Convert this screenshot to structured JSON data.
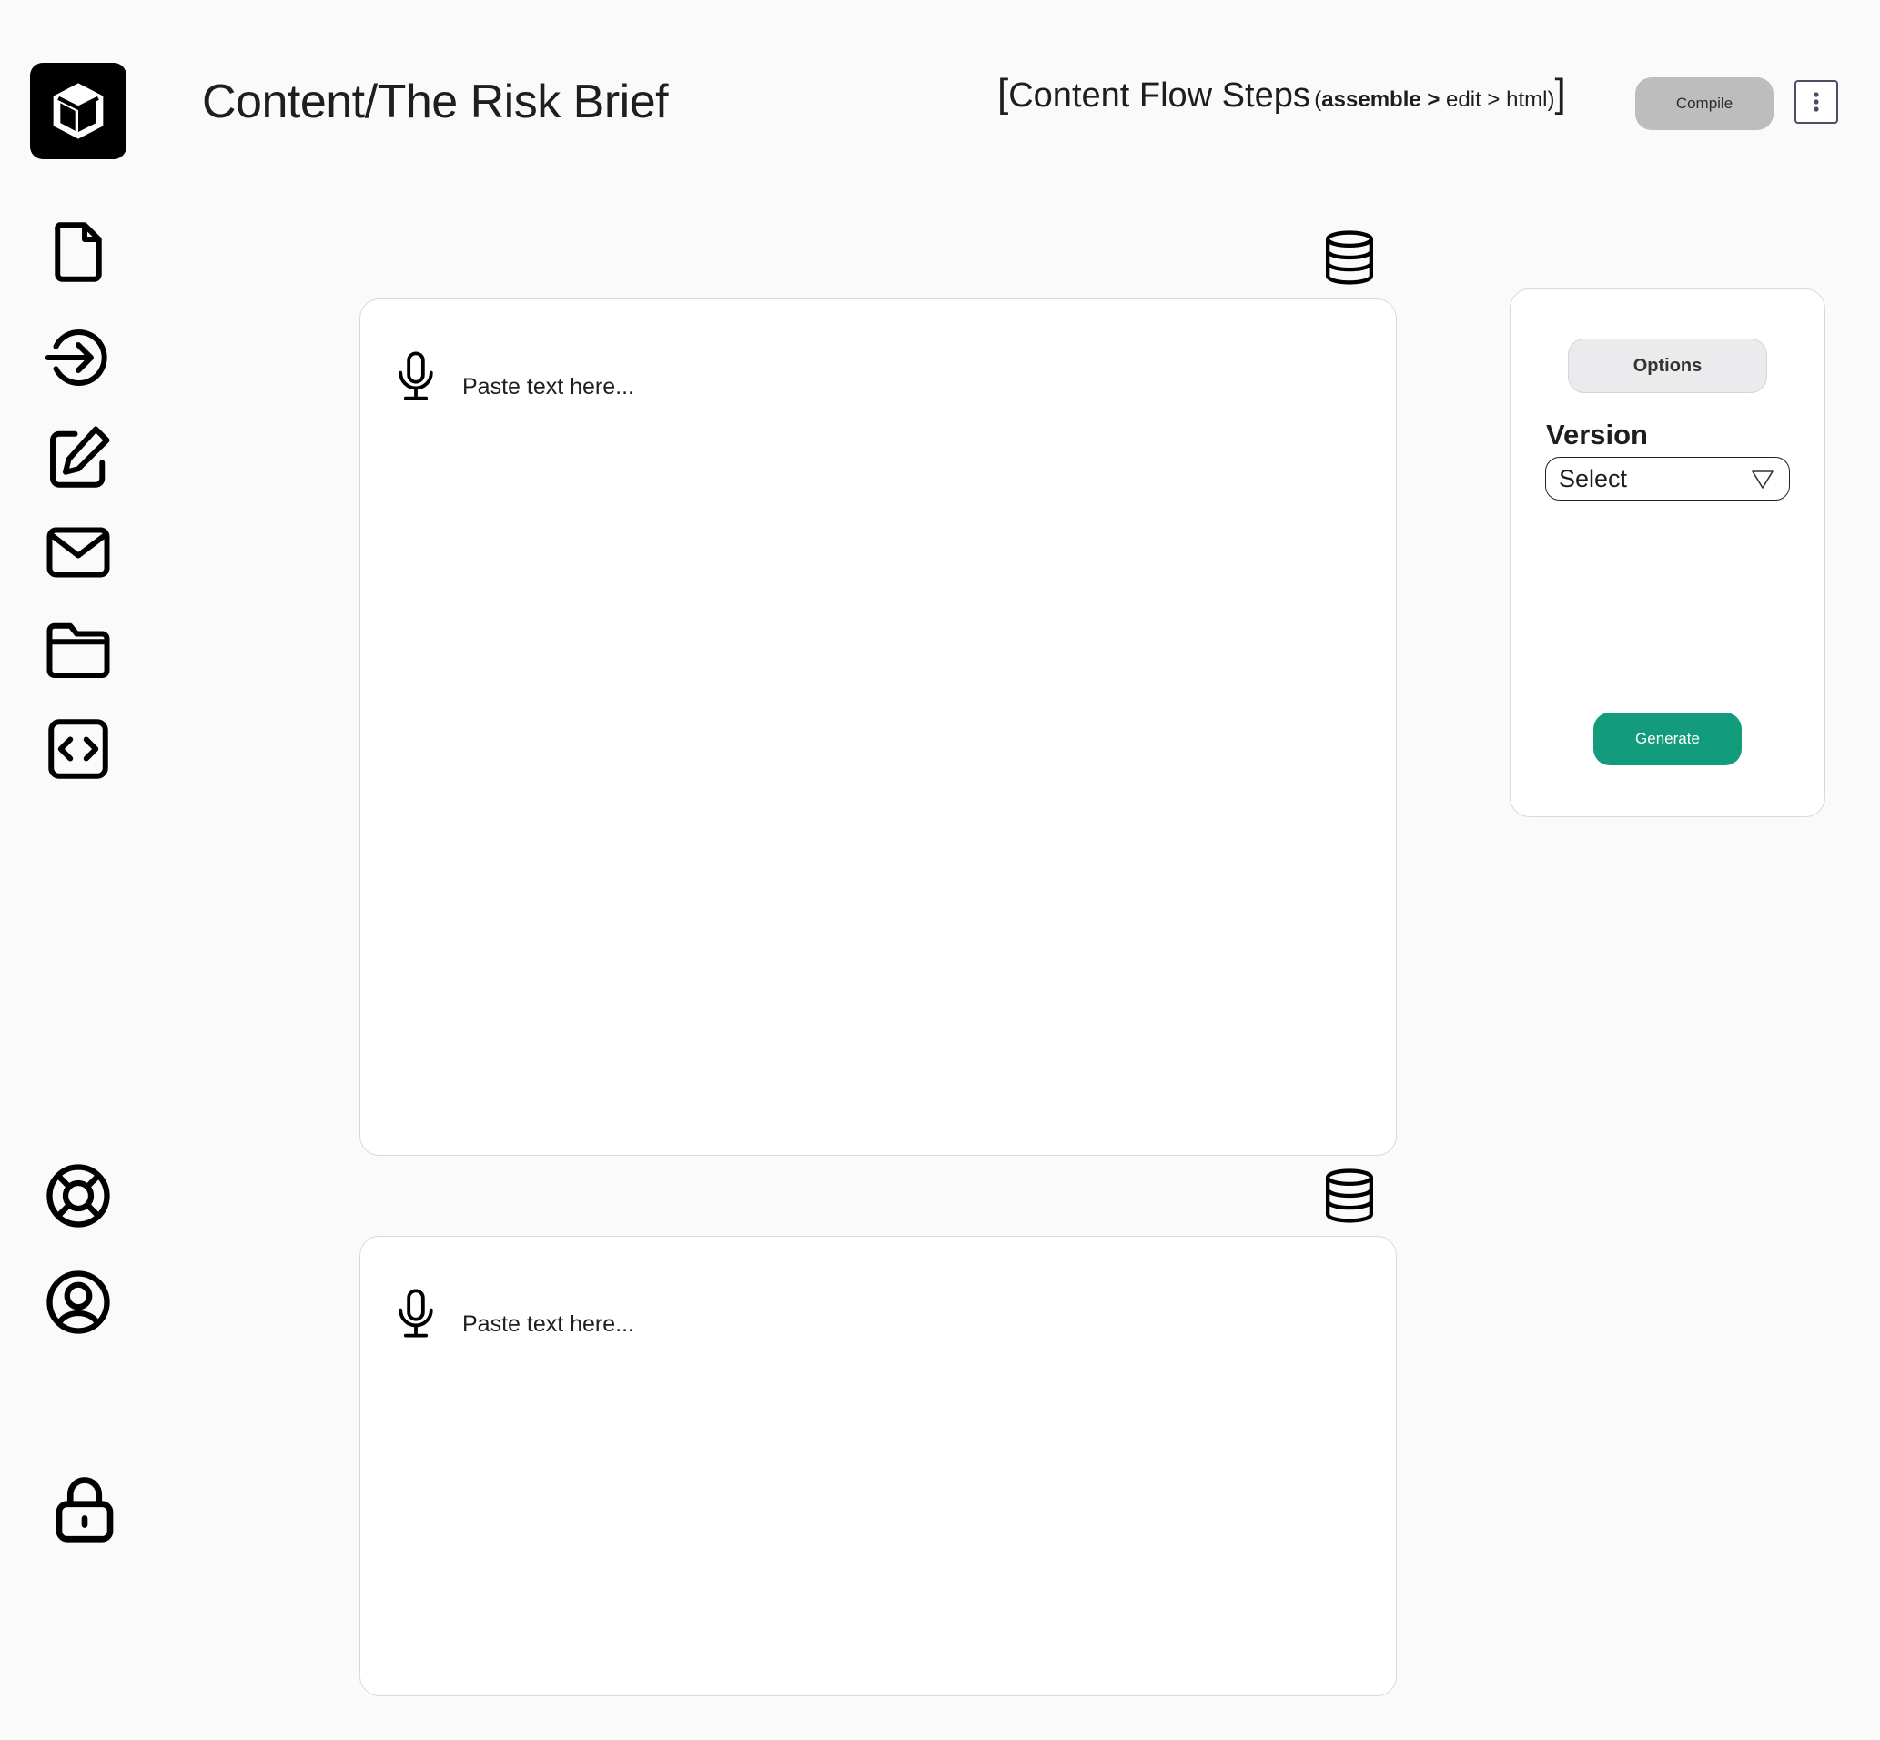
{
  "header": {
    "title": "Content/The Risk Brief",
    "flow_steps": {
      "open_bracket": "[",
      "label": "Content Flow Steps",
      "paren_open": "(",
      "step_active": "assemble >",
      "steps_rest": " edit > html)",
      "close_bracket": "]"
    },
    "compile_label": "Compile",
    "more_menu_icon": "kebab-vertical-icon"
  },
  "sidebar": {
    "logo_icon": "cube-icon",
    "top_items": [
      {
        "icon": "file-icon"
      },
      {
        "icon": "arrow-right-circle-icon"
      },
      {
        "icon": "edit-icon"
      },
      {
        "icon": "mail-icon"
      },
      {
        "icon": "folder-icon"
      },
      {
        "icon": "code-icon"
      }
    ],
    "bottom_items": [
      {
        "icon": "lifebuoy-icon"
      },
      {
        "icon": "user-circle-icon"
      },
      {
        "icon": "lock-icon"
      }
    ]
  },
  "editors": [
    {
      "placeholder": "Paste text here...",
      "mic_icon": "microphone-icon",
      "db_icon": "database-icon"
    },
    {
      "placeholder": "Paste text here...",
      "mic_icon": "microphone-icon",
      "db_icon": "database-icon"
    }
  ],
  "options_panel": {
    "options_label": "Options",
    "version_label": "Version",
    "version_select_value": "Select",
    "generate_label": "Generate"
  },
  "colors": {
    "background": "#fafafa",
    "generate_button": "#139c7c",
    "compile_button": "#bdbdbd",
    "options_button": "#ebebed"
  }
}
